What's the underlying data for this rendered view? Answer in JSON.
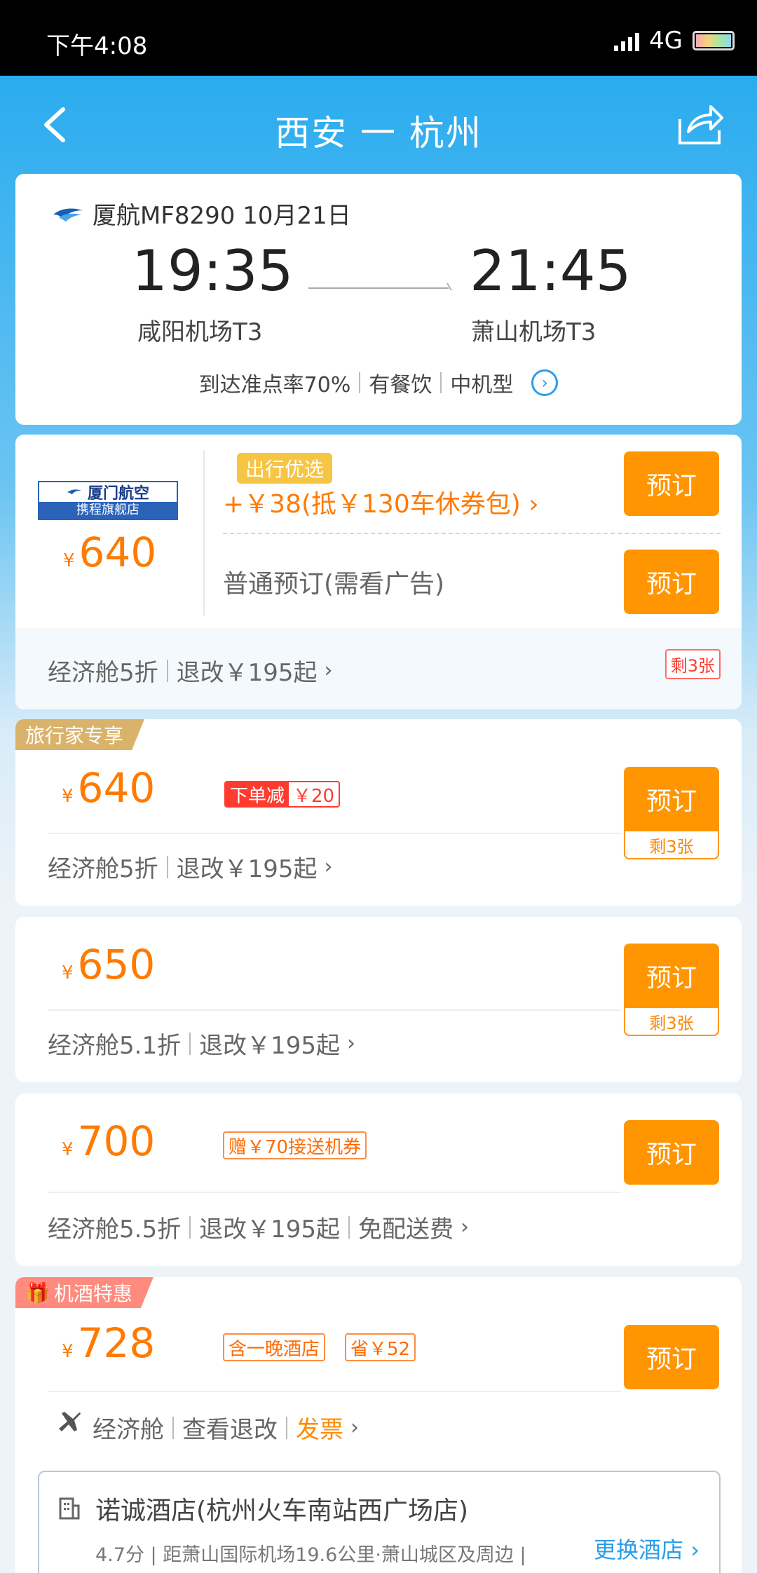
{
  "status_bar": {
    "time": "下午4:08",
    "network": "4G"
  },
  "nav": {
    "title": "西安 一 杭州"
  },
  "flight": {
    "airline_no_date": "厦航MF8290 10月21日",
    "depart_time": "19:35",
    "arrive_time": "21:45",
    "depart_airport": "咸阳机场T3",
    "arrive_airport": "萧山机场T3",
    "tags": [
      "到达准点率70%",
      "有餐饮",
      "中机型"
    ]
  },
  "offer1": {
    "logo_top": "厦门航空",
    "logo_bottom": "携程旗舰店",
    "yen": "¥",
    "price": "640",
    "badge": "出行优选",
    "promo": "+￥38(抵￥130车休券包) ›",
    "plain": "普通预订(需看广告)",
    "book": "预订",
    "cabin": "经济舱5折",
    "refund": "退改￥195起",
    "remain": "剩3张"
  },
  "offer2": {
    "corner": "旅行家专享",
    "yen": "¥",
    "price": "640",
    "discount_a": "下单减",
    "discount_b": "￥20",
    "book": "预订",
    "remain": "剩3张",
    "cabin": "经济舱5折",
    "refund": "退改￥195起"
  },
  "offer3": {
    "yen": "¥",
    "price": "650",
    "book": "预订",
    "remain": "剩3张",
    "cabin": "经济舱5.1折",
    "refund": "退改￥195起"
  },
  "offer4": {
    "yen": "¥",
    "price": "700",
    "gift": "赠￥70接送机券",
    "book": "预订",
    "cabin": "经济舱5.5折",
    "refund": "退改￥195起",
    "delivery": "免配送费"
  },
  "offer5": {
    "corner": "机酒特惠",
    "yen": "¥",
    "price": "728",
    "tag1": "含一晚酒店",
    "tag2": "省￥52",
    "book": "预订",
    "cabin": "经济舱",
    "refund": "查看退改",
    "invoice": "发票",
    "hotel_name": "诺诚酒店(杭州火车南站西广场店)",
    "hotel_meta": "4.7分 | 距萧山国际机场19.6公里·萧山城区及周边 |",
    "change_hotel": "更换酒店"
  },
  "colors": {
    "accent": "#ff9500",
    "price": "#ff7a00",
    "header": "#1ea7ee",
    "link": "#2a9ee8"
  }
}
